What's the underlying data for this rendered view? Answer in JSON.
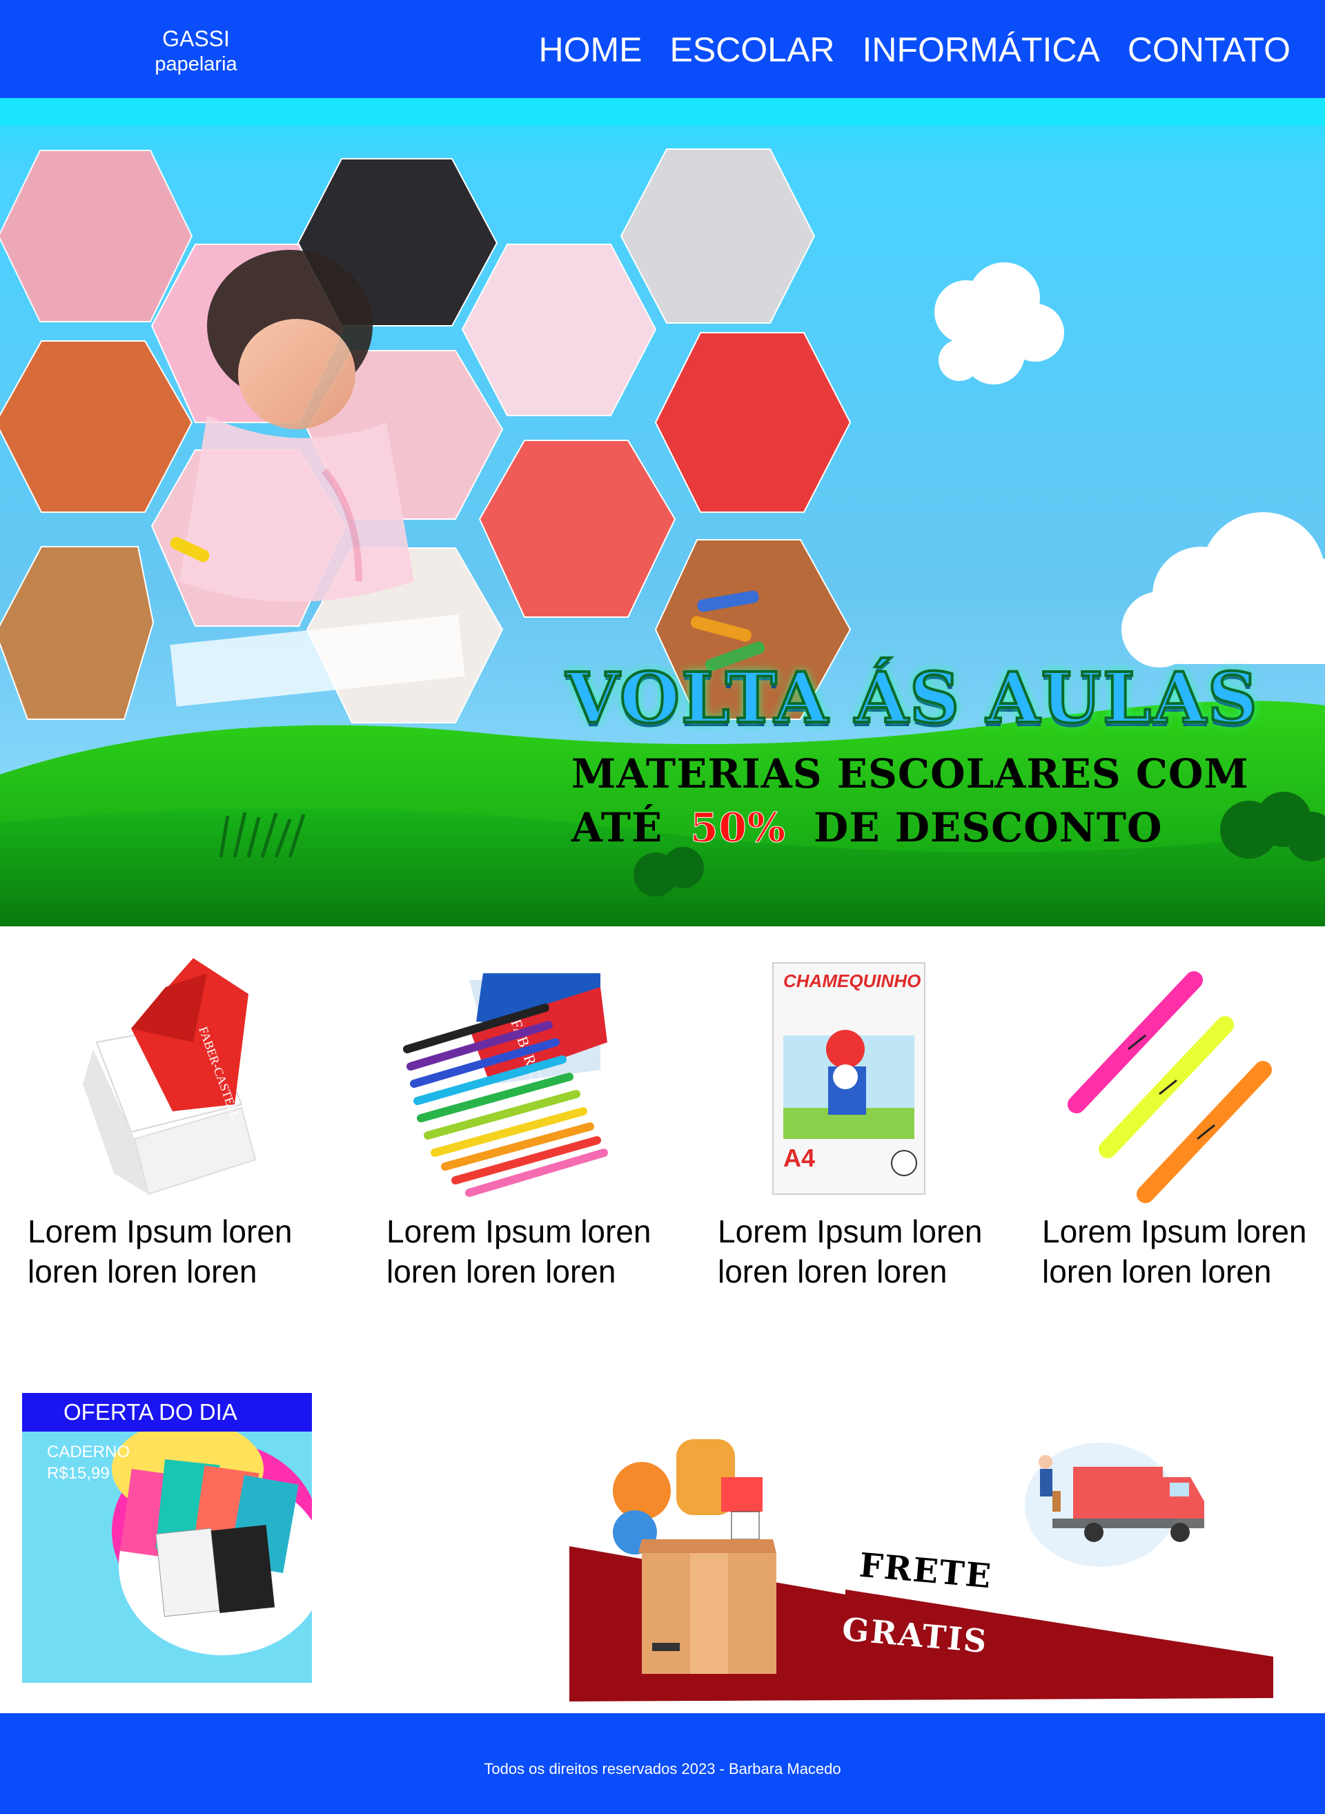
{
  "header": {
    "brand_name": "GASSI",
    "brand_sub": "papelaria",
    "nav": [
      "HOME",
      "ESCOLAR",
      "INFORMÁTICA",
      "CONTATO"
    ]
  },
  "hero": {
    "title": "VOLTA ÁS AULAS",
    "subtitle_line1": "MATERIAS ESCOLARES COM",
    "subtitle_ate": "ATÉ",
    "subtitle_percent": "50%",
    "subtitle_rest": "DE DESCONTO"
  },
  "products": [
    {
      "icon": "eraser-icon",
      "text": "Lorem Ipsum loren loren loren loren"
    },
    {
      "icon": "markers-icon",
      "text": "Lorem Ipsum loren loren loren loren"
    },
    {
      "icon": "paper-ream-icon",
      "text": "Lorem Ipsum loren loren loren loren"
    },
    {
      "icon": "highlighters-icon",
      "text": "Lorem Ipsum loren loren loren loren"
    }
  ],
  "offer": {
    "title": "OFERTA DO DIA",
    "item_name": "CADERNO",
    "item_price": "R$15,99"
  },
  "freight": {
    "line1": "FRETE",
    "line2": "GRATIS"
  },
  "footer": {
    "text": "Todos os direitos reservados 2023 - Barbara Macedo"
  },
  "colors": {
    "header_bg": "#0a4dfa",
    "sky": "#5cc8f5",
    "grass": "#1fbf1a",
    "offer_bar": "#1a14f0",
    "freight_red": "#9a0b14"
  }
}
